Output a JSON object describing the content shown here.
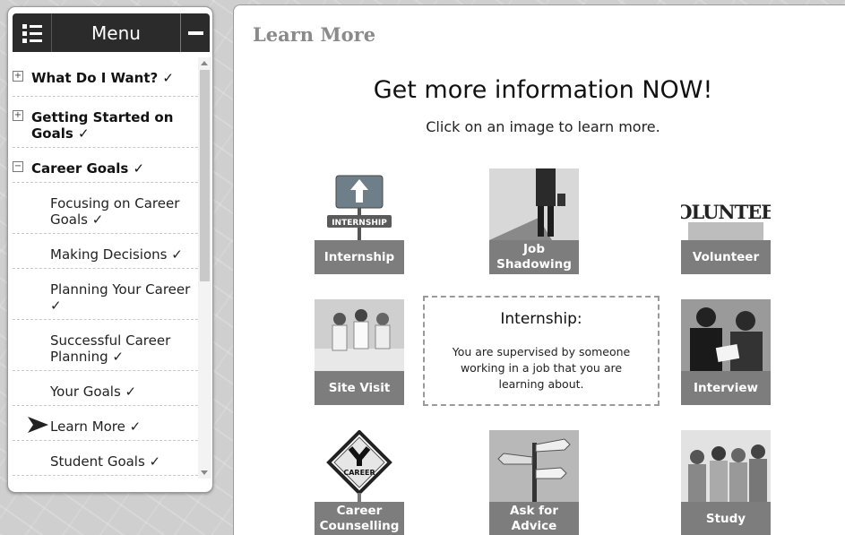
{
  "menu": {
    "title": "Menu",
    "items": [
      {
        "label": "What Do I Want? ✓",
        "toggle": "+"
      },
      {
        "label": "Getting Started on Goals ✓",
        "toggle": "+"
      },
      {
        "label": "Career Goals ✓",
        "toggle": "−"
      },
      {
        "label": "Focusing on Career Goals ✓"
      },
      {
        "label": "Making Decisions ✓"
      },
      {
        "label": "Planning Your Career ✓"
      },
      {
        "label": "Successful Career Planning ✓"
      },
      {
        "label": "Your Goals ✓"
      },
      {
        "label": "Learn More ✓",
        "current": true
      },
      {
        "label": "Student Goals ✓"
      }
    ]
  },
  "content": {
    "page_title": "Learn More",
    "headline": "Get more information NOW!",
    "subhead": "Click on an image to learn more.",
    "tiles": [
      {
        "label": "Internship",
        "sign_text": "INTERNSHIP"
      },
      {
        "label": "Job Shadowing"
      },
      {
        "label": "Volunteer",
        "sign_text": "VOLUNTEER"
      },
      {
        "label": "Site Visit"
      },
      {
        "label": "Interview"
      },
      {
        "label": "Career Counselling",
        "sign_text": "CAREER"
      },
      {
        "label": "Ask for Advice"
      },
      {
        "label": "Study"
      }
    ],
    "info": {
      "title": "Internship:",
      "text": "You are supervised by someone working in a job that you are learning about."
    }
  }
}
